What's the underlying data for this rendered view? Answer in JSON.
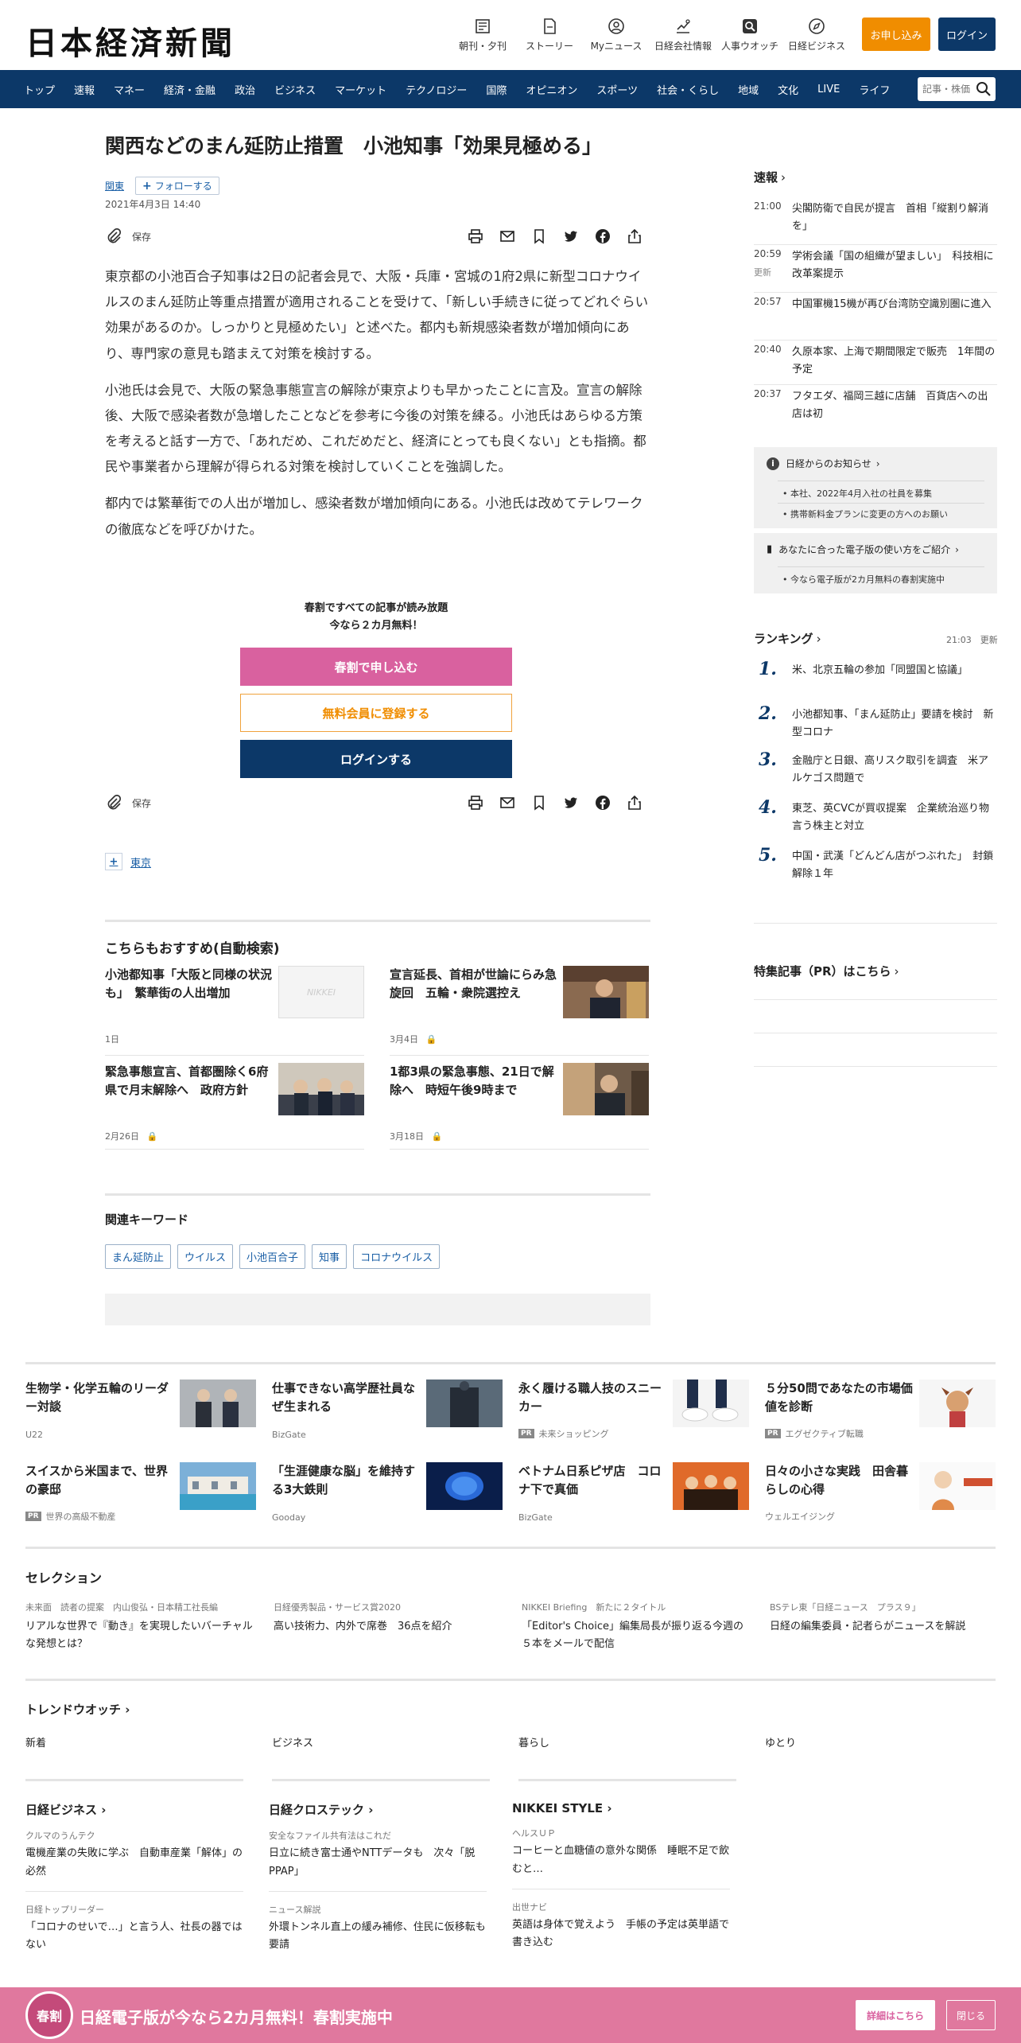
{
  "header": {
    "logo": "日本経済新聞",
    "nav": [
      {
        "label": "朝刊・夕刊",
        "icon": "newspaper-icon"
      },
      {
        "label": "ストーリー",
        "icon": "document-icon"
      },
      {
        "label": "Myニュース",
        "icon": "user-icon"
      },
      {
        "label": "日経会社情報",
        "icon": "chart-icon"
      },
      {
        "label": "人事ウオッチ",
        "icon": "search-person-icon"
      },
      {
        "label": "日経ビジネス",
        "icon": "compass-icon"
      }
    ],
    "apply_label": "お申し込み",
    "login_label": "ログイン"
  },
  "main_nav": {
    "items": [
      "トップ",
      "速報",
      "マネー",
      "経済・金融",
      "政治",
      "ビジネス",
      "マーケット",
      "テクノロジー",
      "国際",
      "オピニオン",
      "スポーツ",
      "社会・くらし",
      "地域",
      "文化",
      "LIVE",
      "ライフ"
    ],
    "search_placeholder": "記事・株価"
  },
  "article": {
    "title": "関西などのまん延防止措置　小池知事「効果見極める」",
    "region_tag": "関東",
    "follow_label": "フォローする",
    "date": "2021年4月3日 14:40",
    "save_label": "保存",
    "paragraphs": [
      "東京都の小池百合子知事は2日の記者会見で、大阪・兵庫・宮城の1府2県に新型コロナウイルスのまん延防止等重点措置が適用されることを受けて、「新しい手続きに従ってどれぐらい効果があるのか。しっかりと見極めたい」と述べた。都内も新規感染者数が増加傾向にあり、専門家の意見も踏まえて対策を検討する。",
      "小池氏は会見で、大阪の緊急事態宣言の解除が東京よりも早かったことに言及。宣言の解除後、大阪で感染者数が急増したことなどを参考に今後の対策を練る。小池氏はあらゆる方策を考えると話す一方で、「あれだめ、これだめだと、経済にとっても良くない」とも指摘。都民や事業者から理解が得られる対策を検討していくことを強調した。",
      "都内では繁華街での人出が増加し、感染者数が増加傾向にある。小池氏は改めてテレワークの徹底などを呼びかけた。"
    ],
    "promo_line1": "春割ですべての記事が読み放題",
    "promo_line2": "今なら２カ月無料！",
    "promo_btn1": "春割で申し込む",
    "promo_btn2": "無料会員に登録する",
    "promo_btn3": "ログインする",
    "tag_tokyo": "東京"
  },
  "recommend": {
    "title": "こちらもおすすめ(自動検索)",
    "items": [
      {
        "title": "小池都知事「大阪と同様の状況も」　繁華街の人出増加",
        "date": "1日",
        "locked": false,
        "thumb": "none",
        "placeholder": "NIKKEI"
      },
      {
        "title": "宣言延長、首相が世論にらみ急旋回　五輪・衆院選控え",
        "date": "3月4日",
        "locked": true,
        "thumb": "photo"
      },
      {
        "title": "緊急事態宣言、首都圏除く6府県で月末解除へ　政府方針",
        "date": "2月26日",
        "locked": true,
        "thumb": "photo"
      },
      {
        "title": "1都3県の緊急事態、21日で解除へ　時短午後9時まで",
        "date": "3月18日",
        "locked": true,
        "thumb": "photo"
      }
    ]
  },
  "keywords": {
    "title": "関連キーワード",
    "items": [
      "まん延防止",
      "ウイルス",
      "小池百合子",
      "知事",
      "コロナウイルス"
    ]
  },
  "sidebar": {
    "sokuho_title": "速報",
    "sokuho": [
      {
        "time": "21:00",
        "text": "尖閣防衛で自民が提言　首相「縦割り解消を」",
        "updated": ""
      },
      {
        "time": "20:59",
        "text": "学術会議「国の組織が望ましい」　科技相に改革案提示",
        "updated": "更新"
      },
      {
        "time": "20:57",
        "text": "中国軍機15機が再び台湾防空識別圏に進入",
        "updated": ""
      },
      {
        "time": "20:40",
        "text": "久原本家、上海で期間限定で販売　1年間の予定",
        "updated": ""
      },
      {
        "time": "20:37",
        "text": "フタエダ、福岡三越に店舗　百貨店への出店は初",
        "updated": ""
      }
    ],
    "notice1": {
      "title": "日経からのお知らせ",
      "items": [
        "本社、2022年4月入社の社員を募集",
        "携帯新料金プランに変更の方へのお願い"
      ]
    },
    "notice2": {
      "title": "あなたに合った電子版の使い方をご紹介",
      "items": [
        "今なら電子版が2カ月無料の春割実施中"
      ]
    },
    "ranking_title": "ランキング",
    "ranking_time": "21:03",
    "ranking_updated": "更新",
    "ranking": [
      {
        "rank": "1.",
        "text": "米、北京五輪の参加「同盟国と協議」"
      },
      {
        "rank": "2.",
        "text": "小池都知事、「まん延防止」要請を検討　新型コロナ"
      },
      {
        "rank": "3.",
        "text": "金融庁と日銀、高リスク取引を調査　米アルケゴス問題で"
      },
      {
        "rank": "4.",
        "text": "東芝、英CVCが買収提案　企業統治巡り物言う株主と対立"
      },
      {
        "rank": "5.",
        "text": "中国・武漢「どんどん店がつぶれた」　封鎖解除１年"
      }
    ],
    "pr_title": "特集記事（PR）はこちら"
  },
  "ads": [
    {
      "title": "生物学・化学五輪のリーダー対談",
      "source": "U22",
      "pr": false
    },
    {
      "title": "仕事できない高学歴社員なぜ生まれる",
      "source": "BizGate",
      "pr": false
    },
    {
      "title": "永く履ける職人技のスニーカー",
      "source": "未来ショッピング",
      "pr": true
    },
    {
      "title": "５分50問であなたの市場価値を診断",
      "source": "エグゼクティブ転職",
      "pr": true
    },
    {
      "title": "スイスから米国まで、世界の豪邸",
      "source": "世界の高級不動産",
      "pr": true
    },
    {
      "title": "「生涯健康な脳」を維持する3大鉄則",
      "source": "Gooday",
      "pr": false
    },
    {
      "title": "ベトナム日系ピザ店　コロナ下で真価",
      "source": "BizGate",
      "pr": false
    },
    {
      "title": "日々の小さな実践　田舎暮らしの心得",
      "source": "ウェルエイジング",
      "pr": false
    }
  ],
  "selection": {
    "title": "セレクション",
    "items": [
      {
        "cat": "未来面　読者の提案　内山俊弘・日本精工社長編",
        "title": "リアルな世界で『動き』を実現したいバーチャルな発想とは？"
      },
      {
        "cat": "日経優秀製品・サービス賞2020",
        "title": "高い技術力、内外で席巻　36点を紹介"
      },
      {
        "cat": "NIKKEI Briefing　新たに２タイトル",
        "title": "「Editor's Choice」編集局長が振り返る今週の５本をメールで配信"
      },
      {
        "cat": "BSテレ東「日経ニュース　プラス９」",
        "title": "日経の編集委員・記者らがニュースを解説"
      }
    ]
  },
  "trend": {
    "title": "トレンドウオッチ",
    "cats": [
      "新着",
      "ビジネス",
      "暮らし",
      "ゆとり"
    ],
    "groups": [
      {
        "title": "日経ビジネス",
        "items": [
          {
            "cat": "クルマのうんテク",
            "title": "電機産業の失敗に学ぶ　自動車産業「解体」の必然"
          },
          {
            "cat": "日経トップリーダー",
            "title": "「コロナのせいで…」と言う人、社長の器ではない"
          }
        ]
      },
      {
        "title": "日経クロステック",
        "items": [
          {
            "cat": "安全なファイル共有法はこれだ",
            "title": "日立に続き富士通やNTTデータも　次々「脱PPAP」"
          },
          {
            "cat": "ニュース解説",
            "title": "外環トンネル直上の緩み補修、住民に仮移転も要請"
          }
        ]
      },
      {
        "title": "NIKKEI STYLE",
        "items": [
          {
            "cat": "ヘルスＵＰ",
            "title": "コーヒーと血糖値の意外な関係　睡眠不足で飲むと…"
          },
          {
            "cat": "出世ナビ",
            "title": "英語は身体で覚えよう　手帳の予定は英単語で書き込む"
          }
        ]
      }
    ]
  },
  "banner": {
    "seal": "春割",
    "text": "日経電子版が今なら2カ月無料！春割実施中",
    "detail_label": "詳細はこちら",
    "close_label": "閉じる"
  }
}
